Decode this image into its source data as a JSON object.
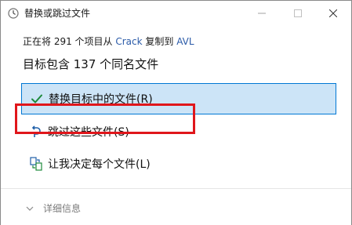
{
  "window": {
    "title": "替换或跳过文件",
    "controls": {
      "minimize_icon": "minimize-icon",
      "maximize_icon": "maximize-icon",
      "close_icon": "close-icon"
    }
  },
  "summary": {
    "prefix": "正在将 291 个项目从 ",
    "source": "Crack",
    "middle": " 复制到 ",
    "destination": "AVL"
  },
  "heading": "目标包含 137 个同名文件",
  "options": [
    {
      "label": "替换目标中的文件(R)",
      "icon": "checkmark-icon",
      "selected": true
    },
    {
      "label": "跳过这些文件(S)",
      "icon": "skip-arrow-icon",
      "selected": false
    },
    {
      "label": "让我决定每个文件(L)",
      "icon": "decide-files-icon",
      "selected": false
    }
  ],
  "footer": {
    "details_label": "详细信息",
    "details_icon": "chevron-down-icon"
  },
  "colors": {
    "selected_background": "#cce4f7",
    "selected_border": "#0078d4",
    "annotation_red": "#e0161b",
    "link_blue": "#2a5aa8"
  }
}
